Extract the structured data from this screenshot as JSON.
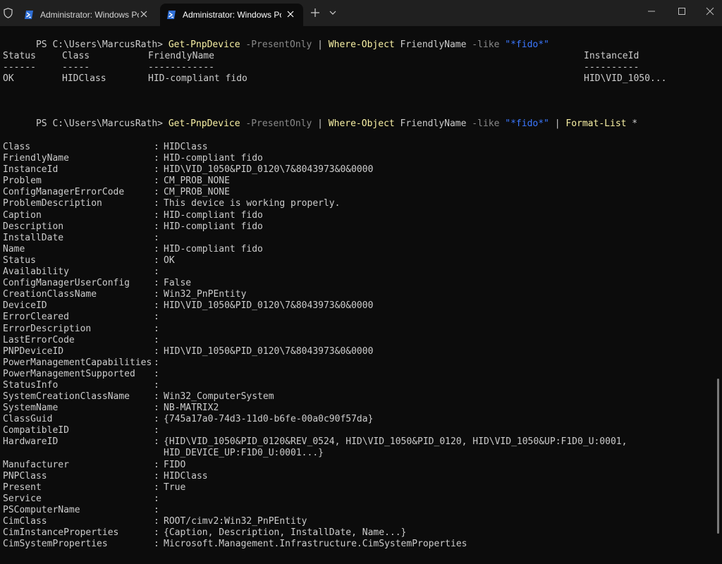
{
  "tabs": [
    {
      "title": "Administrator: Windows PowerShell",
      "active": false
    },
    {
      "title": "Administrator: Windows PowerShell",
      "active": true
    }
  ],
  "commands": [
    {
      "prompt": "PS C:\\Users\\MarcusRath> ",
      "tokens": [
        {
          "text": "Get-PnpDevice",
          "color": "#f9f1a5"
        },
        {
          "text": " -PresentOnly",
          "color": "#8a8a8a"
        },
        {
          "text": " | ",
          "color": "#cccccc"
        },
        {
          "text": "Where-Object",
          "color": "#f9f1a5"
        },
        {
          "text": " FriendlyName",
          "color": "#cccccc"
        },
        {
          "text": " -like",
          "color": "#8a8a8a"
        },
        {
          "text": " \"*fido*\"",
          "color": "#3b78ff"
        }
      ]
    },
    {
      "prompt": "PS C:\\Users\\MarcusRath> ",
      "tokens": [
        {
          "text": "Get-PnpDevice",
          "color": "#f9f1a5"
        },
        {
          "text": " -PresentOnly",
          "color": "#8a8a8a"
        },
        {
          "text": " | ",
          "color": "#cccccc"
        },
        {
          "text": "Where-Object",
          "color": "#f9f1a5"
        },
        {
          "text": " FriendlyName",
          "color": "#cccccc"
        },
        {
          "text": " -like",
          "color": "#8a8a8a"
        },
        {
          "text": " \"*fido*\"",
          "color": "#3b78ff"
        },
        {
          "text": " | ",
          "color": "#cccccc"
        },
        {
          "text": "Format-List",
          "color": "#f9f1a5"
        },
        {
          "text": " *",
          "color": "#cccccc"
        }
      ]
    }
  ],
  "table": {
    "headers": [
      "Status",
      "Class",
      "FriendlyName",
      "InstanceId"
    ],
    "underlines": [
      "------",
      "-----",
      "------------",
      "----------"
    ],
    "row": [
      "OK",
      "HIDClass",
      "HID-compliant fido",
      "HID\\VID_1050..."
    ]
  },
  "properties": [
    {
      "name": "Class",
      "value": "HIDClass"
    },
    {
      "name": "FriendlyName",
      "value": "HID-compliant fido"
    },
    {
      "name": "InstanceId",
      "value": "HID\\VID_1050&PID_0120\\7&8043973&0&0000"
    },
    {
      "name": "Problem",
      "value": "CM_PROB_NONE"
    },
    {
      "name": "ConfigManagerErrorCode",
      "value": "CM_PROB_NONE"
    },
    {
      "name": "ProblemDescription",
      "value": "This device is working properly."
    },
    {
      "name": "Caption",
      "value": "HID-compliant fido"
    },
    {
      "name": "Description",
      "value": "HID-compliant fido"
    },
    {
      "name": "InstallDate",
      "value": ""
    },
    {
      "name": "Name",
      "value": "HID-compliant fido"
    },
    {
      "name": "Status",
      "value": "OK"
    },
    {
      "name": "Availability",
      "value": ""
    },
    {
      "name": "ConfigManagerUserConfig",
      "value": "False"
    },
    {
      "name": "CreationClassName",
      "value": "Win32_PnPEntity"
    },
    {
      "name": "DeviceID",
      "value": "HID\\VID_1050&PID_0120\\7&8043973&0&0000"
    },
    {
      "name": "ErrorCleared",
      "value": ""
    },
    {
      "name": "ErrorDescription",
      "value": ""
    },
    {
      "name": "LastErrorCode",
      "value": ""
    },
    {
      "name": "PNPDeviceID",
      "value": "HID\\VID_1050&PID_0120\\7&8043973&0&0000"
    },
    {
      "name": "PowerManagementCapabilities",
      "value": ""
    },
    {
      "name": "PowerManagementSupported",
      "value": ""
    },
    {
      "name": "StatusInfo",
      "value": ""
    },
    {
      "name": "SystemCreationClassName",
      "value": "Win32_ComputerSystem"
    },
    {
      "name": "SystemName",
      "value": "NB-MATRIX2"
    },
    {
      "name": "ClassGuid",
      "value": "{745a17a0-74d3-11d0-b6fe-00a0c90f57da}"
    },
    {
      "name": "CompatibleID",
      "value": ""
    },
    {
      "name": "HardwareID",
      "value": "{HID\\VID_1050&PID_0120&REV_0524, HID\\VID_1050&PID_0120, HID\\VID_1050&UP:F1D0_U:0001,",
      "value2": "HID_DEVICE_UP:F1D0_U:0001...}"
    },
    {
      "name": "Manufacturer",
      "value": "FIDO"
    },
    {
      "name": "PNPClass",
      "value": "HIDClass"
    },
    {
      "name": "Present",
      "value": "True"
    },
    {
      "name": "Service",
      "value": ""
    },
    {
      "name": "PSComputerName",
      "value": ""
    },
    {
      "name": "CimClass",
      "value": "ROOT/cimv2:Win32_PnPEntity"
    },
    {
      "name": "CimInstanceProperties",
      "value": "{Caption, Description, InstallDate, Name...}"
    },
    {
      "name": "CimSystemProperties",
      "value": "Microsoft.Management.Infrastructure.CimSystemProperties"
    }
  ],
  "separator": ":",
  "colors": {
    "background": "#0c0c0c",
    "tabbar": "#202020",
    "foreground": "#cccccc",
    "command": "#f9f1a5",
    "parameter": "#8a8a8a",
    "string": "#3b78ff"
  },
  "icons": [
    "shield-icon",
    "powershell-icon",
    "close-icon",
    "plus-icon",
    "chevron-down-icon",
    "minimize-icon",
    "maximize-icon",
    "window-close-icon"
  ]
}
